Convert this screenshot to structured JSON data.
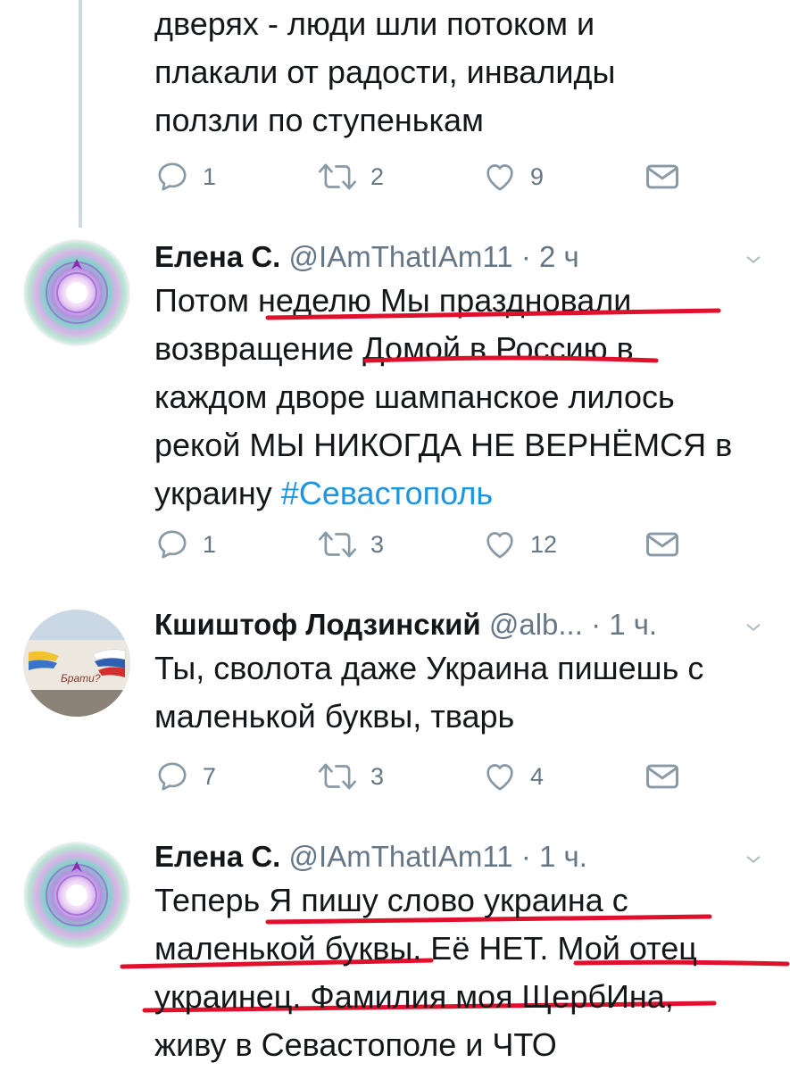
{
  "tweets": [
    {
      "lines": [
        "дверях - люди шли потоком и",
        "плакали от радости, инвалиды",
        "ползли по ступенькам"
      ],
      "replies": "1",
      "retweets": "2",
      "likes": "9"
    },
    {
      "name": "Елена С.",
      "handle": "@IAmThatIAm11",
      "time": "· 2 ч",
      "lines": [
        "Потом неделю Мы праздновали",
        "возвращение Домой в Россию в",
        "каждом дворе шампанское лилось",
        "рекой МЫ НИКОГДА НЕ ВЕРНЁМСЯ в"
      ],
      "last_line_text": "украину ",
      "hashtag": "#Севастополь",
      "replies": "1",
      "retweets": "3",
      "likes": "12"
    },
    {
      "name": "Кшиштоф Лодзинский",
      "handle": "@alb...",
      "time": "· 1 ч.",
      "lines": [
        "Ты, сволота даже Украина пишешь с",
        "маленькой буквы, тварь"
      ],
      "replies": "7",
      "retweets": "3",
      "likes": "4",
      "avatar_caption": "Брати?"
    },
    {
      "name": "Елена С.",
      "handle": "@IAmThatIAm11",
      "time": "· 1 ч.",
      "lines": [
        "Теперь Я пишу слово украина с",
        "маленькой буквы. Её НЕТ. Мой отец",
        "украинец. Фамилия моя ЩербИна,",
        "живу в Севастополе и ЧТО"
      ]
    }
  ],
  "colors": {
    "text": "#14171a",
    "secondary": "#657786",
    "hashtag": "#1b95e0",
    "underline": "#e0102c",
    "thread_line": "#cfd9de"
  },
  "icons": [
    "reply-icon",
    "retweet-icon",
    "like-icon",
    "message-icon",
    "chevron-down-icon"
  ]
}
